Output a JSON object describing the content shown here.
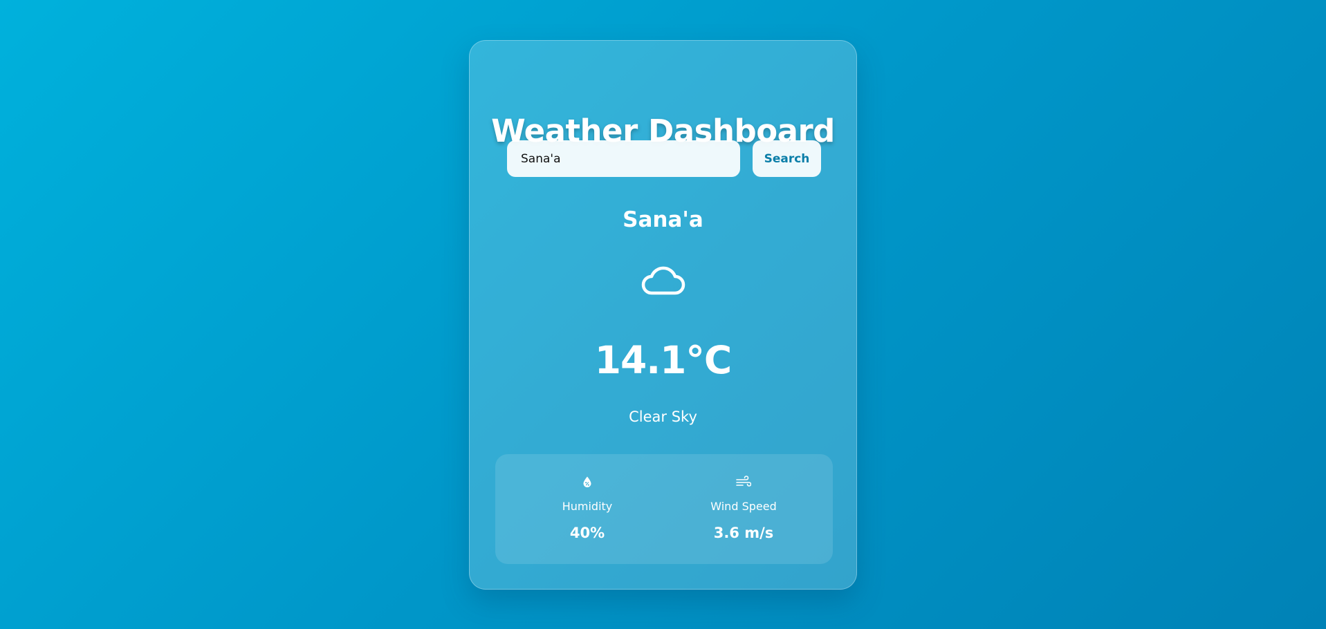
{
  "app": {
    "title": "Weather Dashboard"
  },
  "search": {
    "value": "Sana'a",
    "button_label": "Search"
  },
  "weather": {
    "city": "Sana'a",
    "icon": "cloud-icon",
    "temperature": "14.1°C",
    "description": "Clear Sky"
  },
  "details": {
    "humidity": {
      "icon": "humidity-drop-icon",
      "label": "Humidity",
      "value": "40%"
    },
    "wind": {
      "icon": "wind-icon",
      "label": "Wind Speed",
      "value": "3.6 m/s"
    }
  },
  "colors": {
    "background_start": "#00b1dc",
    "background_end": "#0082b6",
    "button_text": "#0a7ea8",
    "text": "#ffffff"
  }
}
